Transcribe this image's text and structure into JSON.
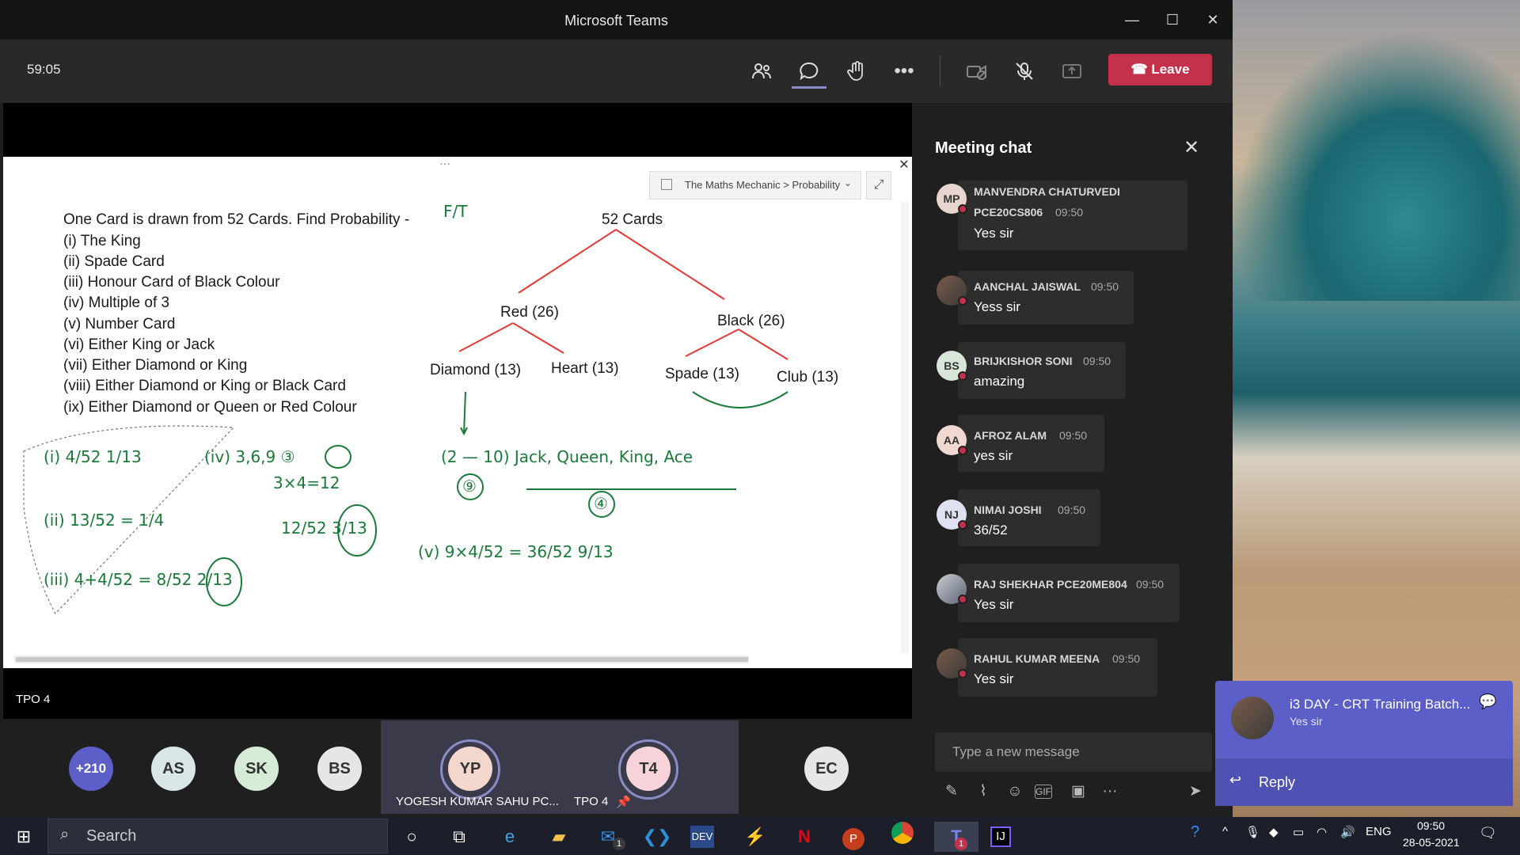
{
  "window": {
    "title": "Microsoft Teams",
    "minimize": "—",
    "maximize": "☐",
    "close": "✕"
  },
  "meeting": {
    "timer": "59:05",
    "leave_label": "Leave",
    "presenter": "TPO 4"
  },
  "whiteboard": {
    "breadcrumb": "The Maths Mechanic > Probability",
    "questions": [
      "One Card is drawn from 52 Cards. Find Probability -",
      "(i) The King",
      "(ii) Spade Card",
      "(iii) Honour Card of Black Colour",
      "(iv) Multiple of 3",
      "(v) Number Card",
      "(vi) Either King or Jack",
      "(vii) Either Diamond or King",
      "(viii) Either Diamond or King or Black Card",
      "(ix) Either Diamond or Queen or Red Colour"
    ],
    "tree": {
      "root": "52 Cards",
      "red": "Red (26)",
      "black": "Black (26)",
      "diamond": "Diamond (13)",
      "heart": "Heart (13)",
      "spade": "Spade (13)",
      "club": "Club (13)"
    },
    "handwriting": {
      "ft": "F/T",
      "h1": "(i)  4/52  1/13",
      "h2": "(ii)  13/52 = 1/4",
      "h3": "(iii)  4+4/52 = 8/52  2/13",
      "h4": "(iv)  3,6,9  ③",
      "h5": "3×4=12",
      "h6": "12/52  3/13",
      "h7": "(2 — 10)  Jack, Queen, King, Ace",
      "h8": "⑨",
      "h9": "④",
      "h10": "(v)  9×4/52 = 36/52  9/13"
    }
  },
  "chat": {
    "title": "Meeting chat",
    "messages": [
      {
        "initials": "MP",
        "sender": "MANVENDRA CHATURVEDI",
        "sender2": "PCE20CS806",
        "time": "09:50",
        "text": "Yes sir"
      },
      {
        "initials": "",
        "sender": "AANCHAL JAISWAL",
        "time": "09:50",
        "text": "Yess sir"
      },
      {
        "initials": "BS",
        "sender": "BRIJKISHOR SONI",
        "time": "09:50",
        "text": "amazing"
      },
      {
        "initials": "AA",
        "sender": "AFROZ ALAM",
        "time": "09:50",
        "text": "yes sir"
      },
      {
        "initials": "NJ",
        "sender": "NIMAI JOSHI",
        "time": "09:50",
        "text": "36/52"
      },
      {
        "initials": "",
        "sender": "RAJ SHEKHAR PCE20ME804",
        "time": "09:50",
        "text": "Yes sir"
      },
      {
        "initials": "",
        "sender": "RAHUL KUMAR MEENA",
        "time": "09:50",
        "text": "Yes sir"
      }
    ],
    "compose_placeholder": "Type a new message"
  },
  "participants": {
    "overflow": "+210",
    "bubbles": [
      "AS",
      "SK",
      "BS",
      "EC"
    ],
    "tiles": [
      {
        "initials": "YP",
        "name": "YOGESH KUMAR SAHU PC..."
      },
      {
        "initials": "T4",
        "name": "TPO 4"
      }
    ]
  },
  "toast": {
    "title": "i3 DAY - CRT Training Batch...",
    "message": "Yes sir",
    "reply": "Reply"
  },
  "taskbar": {
    "search": "Search",
    "lang": "ENG",
    "time": "09:50",
    "date": "28-05-2021",
    "mail_badge": "1",
    "teams_badge": "1"
  },
  "colors": {
    "leave": "#c4314b",
    "accent": "#5b5fc7",
    "tree_lines": "#e53935",
    "ink": "#1a7a3a"
  }
}
